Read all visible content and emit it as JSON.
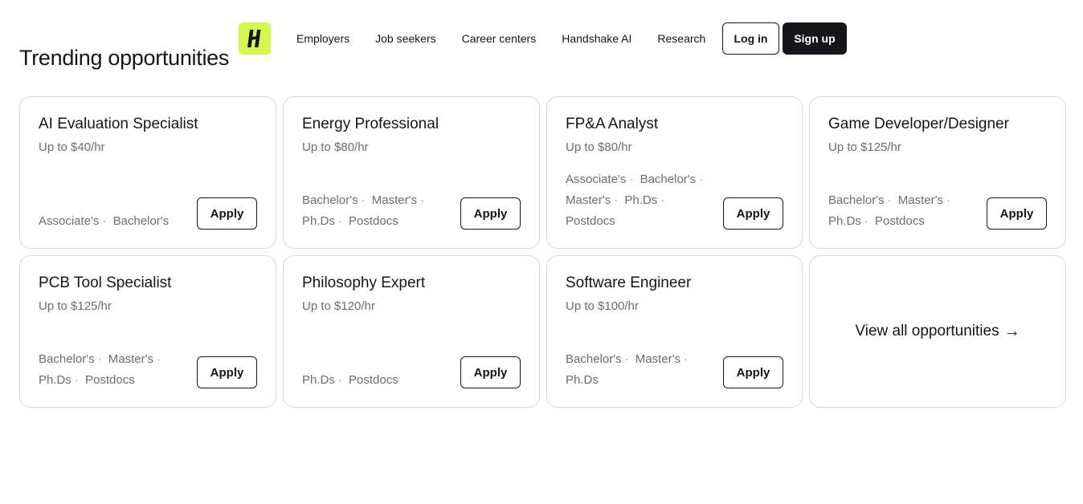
{
  "page": {
    "title": "Trending opportunities"
  },
  "header": {
    "logo_text": "H",
    "nav": [
      "Employers",
      "Job seekers",
      "Career centers",
      "Handshake AI",
      "Research"
    ],
    "login_label": "Log in",
    "signup_label": "Sign up",
    "logo_color": "#d5f84e"
  },
  "opportunities": [
    {
      "title": "AI Evaluation Specialist",
      "pay": "Up to $40/hr",
      "degrees": [
        "Associate's",
        "Bachelor's"
      ],
      "apply_label": "Apply"
    },
    {
      "title": "Energy Professional",
      "pay": "Up to $80/hr",
      "degrees": [
        "Bachelor's",
        "Master's",
        "Ph.Ds",
        "Postdocs"
      ],
      "apply_label": "Apply"
    },
    {
      "title": "FP&A Analyst",
      "pay": "Up to $80/hr",
      "degrees": [
        "Associate's",
        "Bachelor's",
        "Master's",
        "Ph.Ds",
        "Postdocs"
      ],
      "apply_label": "Apply"
    },
    {
      "title": "Game Developer/Designer",
      "pay": "Up to $125/hr",
      "degrees": [
        "Bachelor's",
        "Master's",
        "Ph.Ds",
        "Postdocs"
      ],
      "apply_label": "Apply"
    },
    {
      "title": "PCB Tool Specialist",
      "pay": "Up to $125/hr",
      "degrees": [
        "Bachelor's",
        "Master's",
        "Ph.Ds",
        "Postdocs"
      ],
      "apply_label": "Apply"
    },
    {
      "title": "Philosophy Expert",
      "pay": "Up to $120/hr",
      "degrees": [
        "Ph.Ds",
        "Postdocs"
      ],
      "apply_label": "Apply"
    },
    {
      "title": "Software Engineer",
      "pay": "Up to $100/hr",
      "degrees": [
        "Bachelor's",
        "Master's",
        "Ph.Ds"
      ],
      "apply_label": "Apply"
    }
  ],
  "view_all": {
    "label": "View all opportunities",
    "arrow": "→"
  }
}
